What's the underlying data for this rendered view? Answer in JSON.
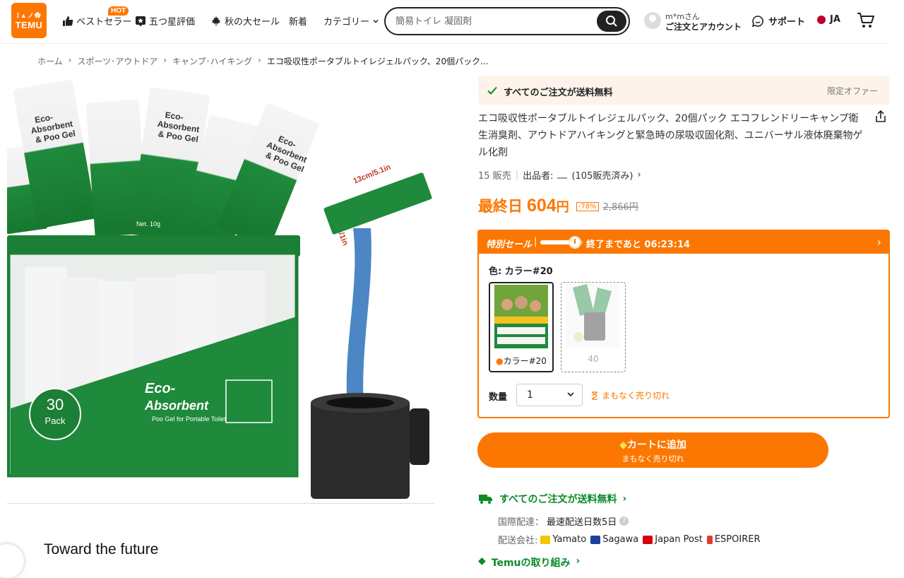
{
  "header": {
    "logo_line1": "ﾐ▲ノ✿",
    "logo_line2": "TEMU",
    "nav": {
      "bestseller": "ベストセラー",
      "hot_badge": "HOT",
      "five_star": "五つ星評価",
      "autumn_sale": "秋の大セール",
      "new_arrivals": "新着",
      "categories": "カテゴリー"
    },
    "search_placeholder": "簡易トイレ 凝固剤",
    "account_name": "m*mさん",
    "account_label": "ご注文とアカウント",
    "support": "サポート",
    "language": "JA"
  },
  "breadcrumb": [
    "ホーム",
    "スポーツ･アウトドア",
    "キャンプ･ハイキング",
    "エコ吸収性ポータブルトイレジェルパック、20個パック..."
  ],
  "product": {
    "shipping_banner": "すべてのご注文が送料無料",
    "limited_offer": "限定オファー",
    "title": "エコ吸収性ポータブルトイレジェルパック、20個パック エコフレンドリーキャンプ衛生消臭剤、アウトドアハイキングと緊急時の尿吸収固化剤、ユニバーサル液体廃棄物ゲル化剤",
    "sold": "15 販売",
    "seller_label": "出品者:",
    "seller_sales": "(105販売済み)",
    "price_label": "最終日",
    "price": "604",
    "price_yen": "円",
    "discount": "-78%",
    "original_price": "2,866円",
    "image_text": {
      "pack_count": "30",
      "pack_word": "Pack",
      "brand_line1": "Eco-",
      "brand_line2": "Absorbent",
      "brand_sub": "Poo Gel for Portable Toilet",
      "pouch_line1": "Eco-",
      "pouch_line2": "Absorbent",
      "pouch_line3": "& Poo Gel",
      "dim_length": "13cm/5.1in",
      "dim_width": "2.5cm/1in",
      "net": "Net. 10g"
    }
  },
  "flash_sale": {
    "label": "特別セール",
    "progress": 0.72,
    "countdown": "終了まであと 06:23:14",
    "color_label": "色: カラー#20",
    "swatches": [
      {
        "caption": "カラー#20",
        "selected": true
      },
      {
        "caption": "40",
        "selected": false
      }
    ],
    "qty_label": "数量",
    "qty_value": "1",
    "selling_out": "まもなく売り切れ"
  },
  "cart_button": {
    "main": "カートに追加",
    "sub": "まもなく売り切れ"
  },
  "shipping": {
    "free": "すべてのご注文が送料無料",
    "intl_label": "国際配達：",
    "intl_value": "最速配送日数5日",
    "carrier_label": "配送会社:",
    "carriers": [
      "Yamato",
      "Sagawa",
      "Japan Post",
      "ESPOIRER"
    ],
    "temu_initiative": "Temuの取り組み"
  },
  "section_heading": "Toward the future",
  "colors": {
    "accent": "#fb7701",
    "green": "#0a8a29",
    "product_green": "#1f8a3c"
  }
}
